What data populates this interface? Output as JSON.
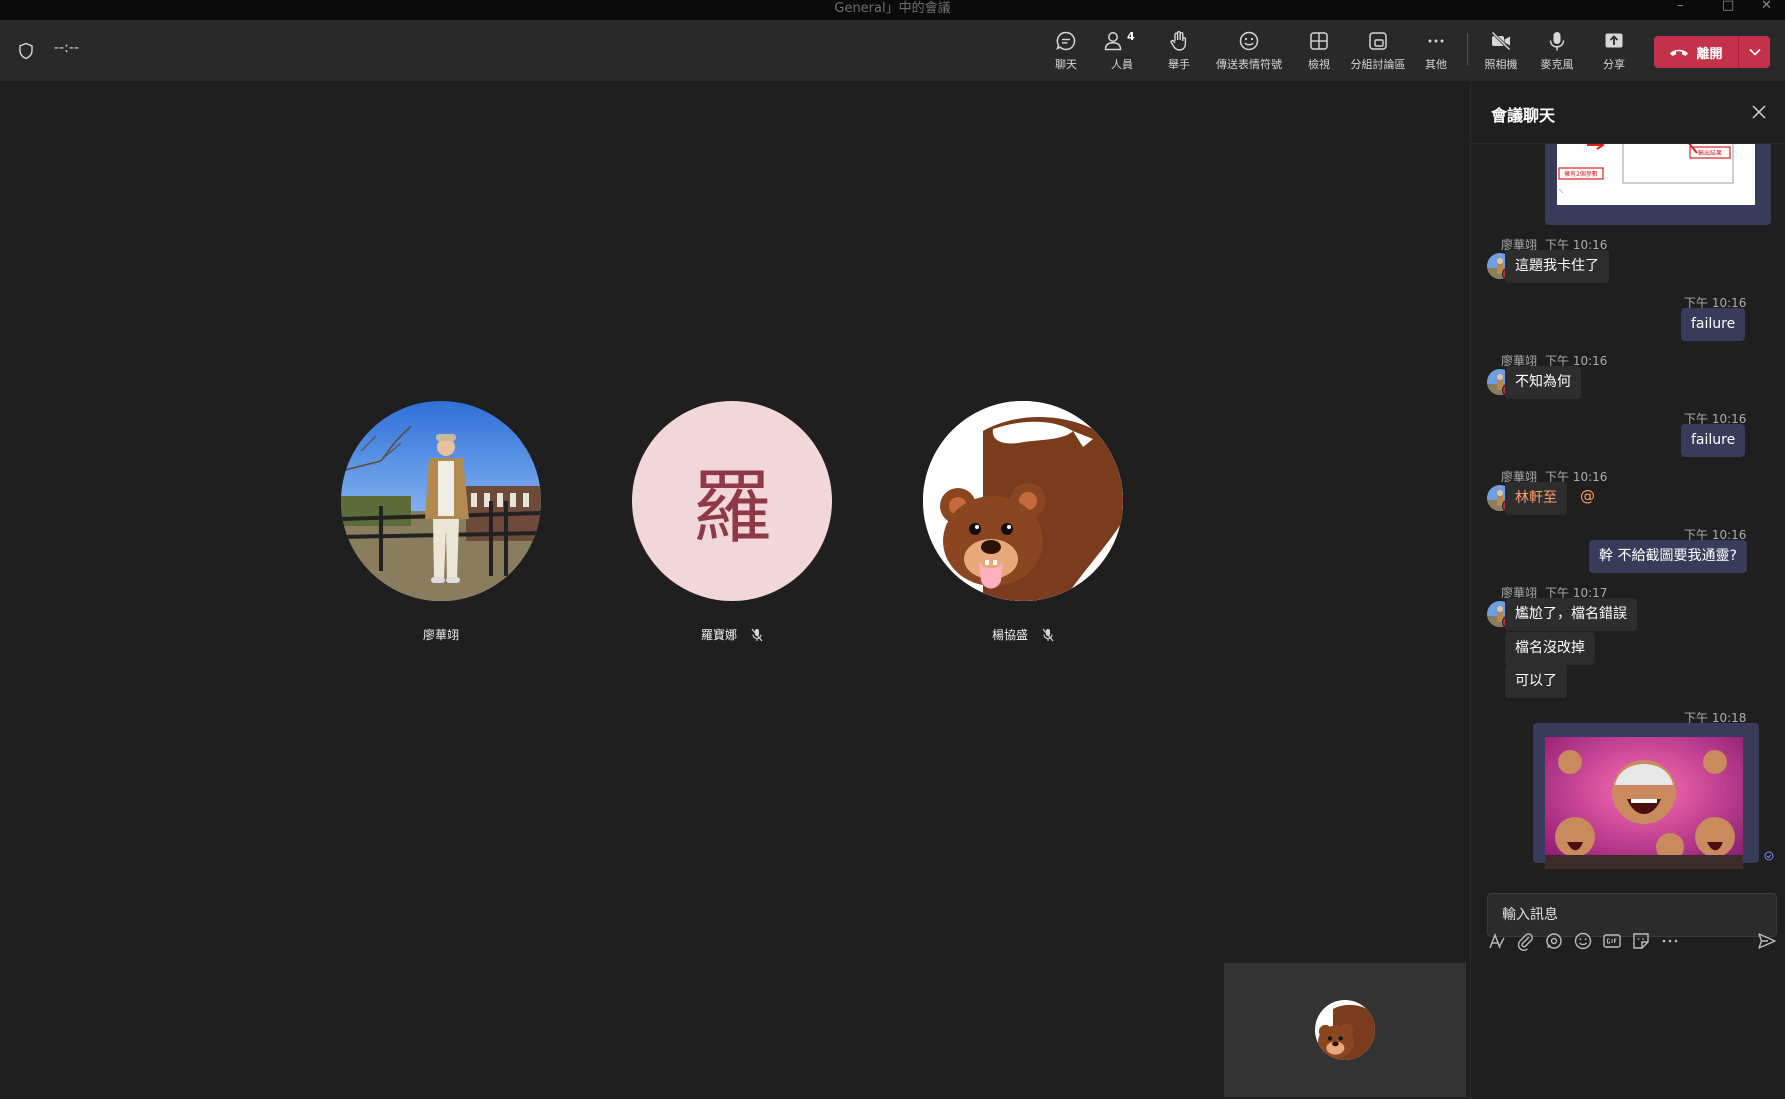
{
  "window": {
    "title": "General」中的會議",
    "controls": [
      "–",
      "□",
      "✕"
    ]
  },
  "toolbar": {
    "timer": "--:--",
    "buttons": [
      {
        "id": "chat",
        "label": "聊天",
        "icon": "chat-bubble-icon"
      },
      {
        "id": "people",
        "label": "人員",
        "icon": "people-icon",
        "badge": "4"
      },
      {
        "id": "raise",
        "label": "舉手",
        "icon": "hand-icon"
      },
      {
        "id": "react",
        "label": "傳送表情符號",
        "icon": "smile-icon"
      },
      {
        "id": "view",
        "label": "檢視",
        "icon": "layout-icon"
      },
      {
        "id": "rooms",
        "label": "分組討論區",
        "icon": "breakout-rooms-icon"
      },
      {
        "id": "more",
        "label": "其他",
        "icon": "ellipsis-icon"
      },
      {
        "id": "camera",
        "label": "照相機",
        "icon": "camera-off-icon"
      },
      {
        "id": "mic",
        "label": "麥克風",
        "icon": "microphone-icon"
      },
      {
        "id": "share",
        "label": "分享",
        "icon": "share-upload-icon"
      }
    ],
    "leave_label": "離開",
    "accent": "#7f85f5",
    "leave_color": "#c4314b"
  },
  "participants": [
    {
      "name": "廖華翊",
      "muted": false,
      "avatar": "photo-person"
    },
    {
      "name": "羅寶娜",
      "muted": true,
      "avatar": "initial",
      "initial": "羅",
      "bg": "#f2d7da",
      "fg": "#8f3848"
    },
    {
      "name": "楊協盛",
      "muted": true,
      "avatar": "cartoon-bear"
    }
  ],
  "chat": {
    "title": "會議聊天",
    "screenshot_labels": [
      "輸出結果",
      "擁有2個參數"
    ],
    "messages": [
      {
        "sender": "廖華翊",
        "time": "下午 10:16",
        "text": "這題我卡住了",
        "own": false
      },
      {
        "time": "下午 10:16",
        "text": "failure",
        "own": true
      },
      {
        "sender": "廖華翊",
        "time": "下午 10:16",
        "text": "不知為何",
        "own": false
      },
      {
        "time": "下午 10:16",
        "text": "failure",
        "own": true
      },
      {
        "sender": "廖華翊",
        "time": "下午 10:16",
        "mention": "林軒至",
        "suffix": "@",
        "own": false
      },
      {
        "time": "下午 10:16",
        "text": "幹 不給截圖要我通靈?",
        "own": true
      },
      {
        "sender": "廖華翊",
        "time": "下午 10:17",
        "lines": [
          "尷尬了，檔名錯誤",
          "檔名沒改掉",
          "可以了"
        ],
        "own": false
      },
      {
        "time": "下午 10:18",
        "image": "laughing-meme-image",
        "own": true
      }
    ],
    "composer_placeholder": "輸入訊息",
    "composer_tools": [
      "format-icon",
      "attach-icon",
      "loop-icon",
      "emoji-icon",
      "gif-icon",
      "sticker-icon",
      "more-options-icon",
      "send-icon"
    ]
  }
}
